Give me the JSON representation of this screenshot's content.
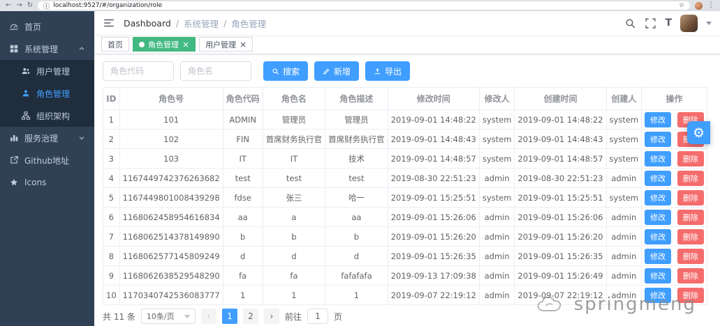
{
  "chrome": {
    "url": "localhost:9527/#/organization/role",
    "back_icon": "←",
    "forward_icon": "→",
    "refresh_icon": "↻",
    "info_icon": "ⓘ",
    "star_icon": "☆",
    "menu_icon": "⋮"
  },
  "sidebar": {
    "home": "首页",
    "system": "系统管理",
    "user_mgmt": "用户管理",
    "role_mgmt": "角色管理",
    "org": "组织架构",
    "service": "服务治理",
    "github": "Github地址",
    "icons": "Icons"
  },
  "navbar": {
    "breadcrumb": [
      "Dashboard",
      "系统管理",
      "角色管理"
    ],
    "separator": "/",
    "text_size_icon": "T"
  },
  "tags": {
    "home": "首页",
    "role": "角色管理",
    "user": "用户管理",
    "close_icon": "×"
  },
  "filters": {
    "code_placeholder": "角色代码",
    "name_placeholder": "角色名",
    "search": "搜索",
    "add": "新增",
    "export": "导出"
  },
  "table": {
    "headers": [
      "ID",
      "角色号",
      "角色代码",
      "角色名",
      "角色描述",
      "修改时间",
      "修改人",
      "创建时间",
      "创建人",
      "操作"
    ],
    "edit_label": "修改",
    "delete_label": "删除",
    "rows": [
      {
        "id": "1",
        "no": "101",
        "code": "ADMIN",
        "name": "管理员",
        "desc": "管理员",
        "mtime": "2019-09-01 14:48:22",
        "muser": "system",
        "ctime": "2019-09-01 14:48:22",
        "cuser": "system"
      },
      {
        "id": "2",
        "no": "102",
        "code": "FIN",
        "name": "首席财务执行官",
        "desc": "首席财务执行官",
        "mtime": "2019-09-01 14:48:43",
        "muser": "system",
        "ctime": "2019-09-01 14:48:43",
        "cuser": "system"
      },
      {
        "id": "3",
        "no": "103",
        "code": "IT",
        "name": "IT",
        "desc": "技术",
        "mtime": "2019-09-01 14:48:57",
        "muser": "system",
        "ctime": "2019-09-01 14:48:57",
        "cuser": "system"
      },
      {
        "id": "4",
        "no": "1167449742376263682",
        "code": "test",
        "name": "test",
        "desc": "test",
        "mtime": "2019-08-30 22:51:23",
        "muser": "admin",
        "ctime": "2019-08-30 22:51:23",
        "cuser": "admin"
      },
      {
        "id": "5",
        "no": "1167449801008439298",
        "code": "fdse",
        "name": "张三",
        "desc": "哈一",
        "mtime": "2019-09-01 15:25:51",
        "muser": "system",
        "ctime": "2019-09-01 15:25:51",
        "cuser": "system"
      },
      {
        "id": "6",
        "no": "1168062458954616834",
        "code": "aa",
        "name": "a",
        "desc": "aa",
        "mtime": "2019-09-01 15:26:06",
        "muser": "admin",
        "ctime": "2019-09-01 15:26:06",
        "cuser": "admin"
      },
      {
        "id": "7",
        "no": "1168062514378149890",
        "code": "b",
        "name": "b",
        "desc": "b",
        "mtime": "2019-09-01 15:26:20",
        "muser": "admin",
        "ctime": "2019-09-01 15:26:20",
        "cuser": "admin"
      },
      {
        "id": "8",
        "no": "1168062577145809249",
        "code": "d",
        "name": "d",
        "desc": "d",
        "mtime": "2019-09-01 15:26:35",
        "muser": "admin",
        "ctime": "2019-09-01 15:26:35",
        "cuser": "admin"
      },
      {
        "id": "9",
        "no": "1168062638529548290",
        "code": "fa",
        "name": "fa",
        "desc": "fafafafa",
        "mtime": "2019-09-13 17:09:38",
        "muser": "admin",
        "ctime": "2019-09-01 15:26:49",
        "cuser": "admin"
      },
      {
        "id": "10",
        "no": "1170340742536083777",
        "code": "1",
        "name": "1",
        "desc": "1",
        "mtime": "2019-09-07 22:19:12",
        "muser": "admin",
        "ctime": "2019-09-07 22:19:12",
        "cuser": "admin"
      }
    ]
  },
  "pagination": {
    "total": "共 11 条",
    "page_size": "10条/页",
    "prev_icon": "‹",
    "pages": [
      "1",
      "2"
    ],
    "next_icon": "›",
    "goto_label": "前往",
    "goto_value": "1",
    "unit": "页"
  },
  "settings": {
    "gear_icon": "⚙"
  },
  "watermark": "springmeng",
  "colors": {
    "primary": "#409eff",
    "danger": "#f56c6c",
    "tag_active": "#42b983",
    "sidebar_bg": "#304156",
    "submenu_bg": "#1f2d3d"
  }
}
